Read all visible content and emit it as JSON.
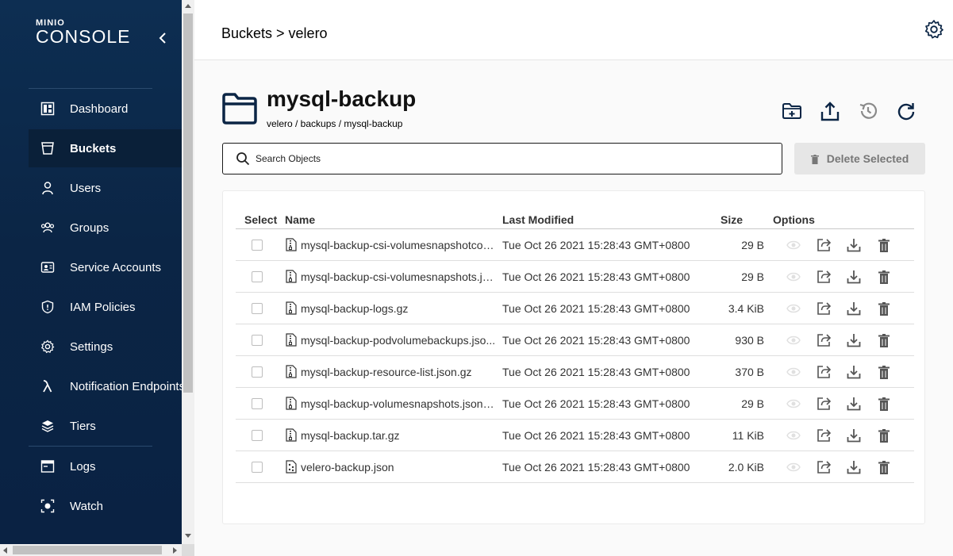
{
  "app": {
    "logo_small": "MINIO",
    "logo_big": "CONSOLE"
  },
  "sidebar": {
    "items": [
      {
        "label": "Dashboard",
        "icon": "dashboard-icon",
        "active": false
      },
      {
        "label": "Buckets",
        "icon": "bucket-icon",
        "active": true
      },
      {
        "label": "Users",
        "icon": "user-icon",
        "active": false
      },
      {
        "label": "Groups",
        "icon": "groups-icon",
        "active": false
      },
      {
        "label": "Service Accounts",
        "icon": "service-accounts-icon",
        "active": false
      },
      {
        "label": "IAM Policies",
        "icon": "shield-icon",
        "active": false
      },
      {
        "label": "Settings",
        "icon": "gear-icon",
        "active": false
      },
      {
        "label": "Notification Endpoints",
        "icon": "lambda-icon",
        "active": false
      },
      {
        "label": "Tiers",
        "icon": "layers-icon",
        "active": false
      },
      {
        "label": "Logs",
        "icon": "logs-icon",
        "active": false
      },
      {
        "label": "Watch",
        "icon": "watch-icon",
        "active": false
      }
    ]
  },
  "header": {
    "breadcrumb": "Buckets > velero"
  },
  "object": {
    "title": "mysql-backup",
    "path": "velero / backups / mysql-backup"
  },
  "search": {
    "placeholder": "Search Objects"
  },
  "actions": {
    "delete_selected": "Delete Selected"
  },
  "table": {
    "columns": {
      "select": "Select",
      "name": "Name",
      "modified": "Last Modified",
      "size": "Size",
      "options": "Options"
    },
    "rows": [
      {
        "name": "mysql-backup-csi-volumesnapshotcon...",
        "modified": "Tue Oct 26 2021 15:28:43 GMT+0800",
        "size": "29 B",
        "icon": "file-zip-icon"
      },
      {
        "name": "mysql-backup-csi-volumesnapshots.js...",
        "modified": "Tue Oct 26 2021 15:28:43 GMT+0800",
        "size": "29 B",
        "icon": "file-zip-icon"
      },
      {
        "name": "mysql-backup-logs.gz",
        "modified": "Tue Oct 26 2021 15:28:43 GMT+0800",
        "size": "3.4 KiB",
        "icon": "file-zip-icon"
      },
      {
        "name": "mysql-backup-podvolumebackups.jso...",
        "modified": "Tue Oct 26 2021 15:28:43 GMT+0800",
        "size": "930 B",
        "icon": "file-zip-icon"
      },
      {
        "name": "mysql-backup-resource-list.json.gz",
        "modified": "Tue Oct 26 2021 15:28:43 GMT+0800",
        "size": "370 B",
        "icon": "file-zip-icon"
      },
      {
        "name": "mysql-backup-volumesnapshots.json.gz",
        "modified": "Tue Oct 26 2021 15:28:43 GMT+0800",
        "size": "29 B",
        "icon": "file-zip-icon"
      },
      {
        "name": "mysql-backup.tar.gz",
        "modified": "Tue Oct 26 2021 15:28:43 GMT+0800",
        "size": "11 KiB",
        "icon": "file-zip-icon"
      },
      {
        "name": "velero-backup.json",
        "modified": "Tue Oct 26 2021 15:28:43 GMT+0800",
        "size": "2.0 KiB",
        "icon": "file-json-icon"
      }
    ]
  },
  "colors": {
    "sidebar_bg": "#0b2545",
    "sidebar_active": "#0a2039",
    "text_dark": "#222222",
    "disabled": "#e6e6e6"
  }
}
